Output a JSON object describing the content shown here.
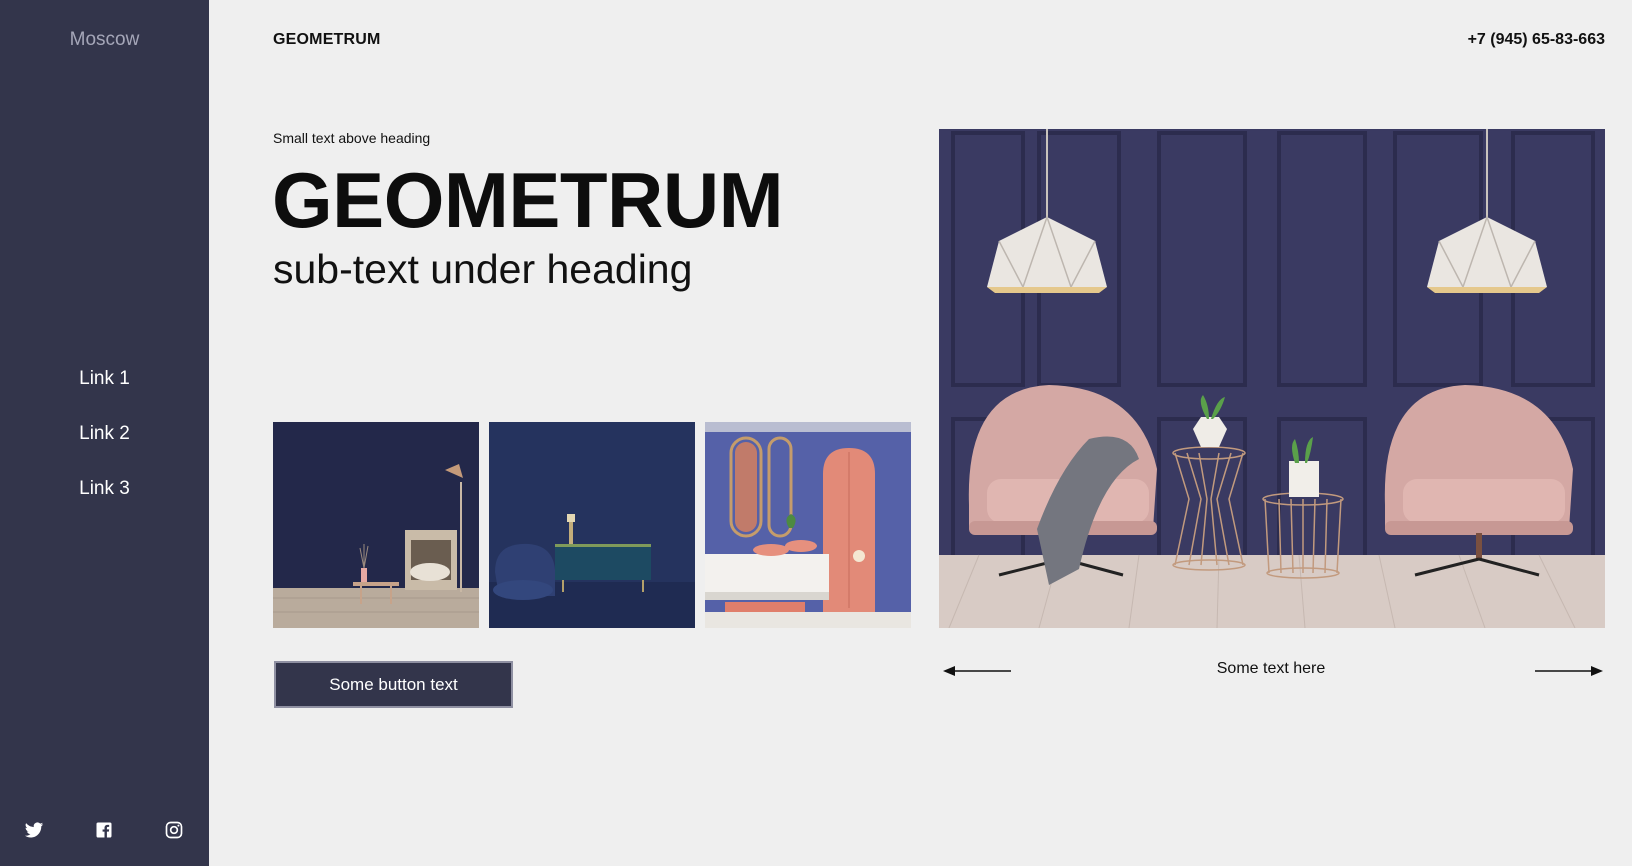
{
  "sidebar": {
    "city": "Moscow",
    "links": [
      "Link 1",
      "Link 2",
      "Link 3"
    ],
    "socials": [
      "twitter-icon",
      "facebook-icon",
      "instagram-icon"
    ]
  },
  "header": {
    "logo": "GEOMETRUM",
    "phone": "+7 (945) 65-83-663"
  },
  "hero": {
    "eyebrow": "Small text above heading",
    "title": "GEOMETRUM",
    "subtitle": "sub-text under heading",
    "button_label": "Some button text"
  },
  "slider": {
    "caption": "Some text here",
    "prev_icon": "arrow-left-icon",
    "next_icon": "arrow-right-icon"
  },
  "colors": {
    "sidebar": "#33354b",
    "background": "#efefef",
    "accent_pink": "#d4a8a4",
    "wall_purple": "#3a3a62"
  }
}
